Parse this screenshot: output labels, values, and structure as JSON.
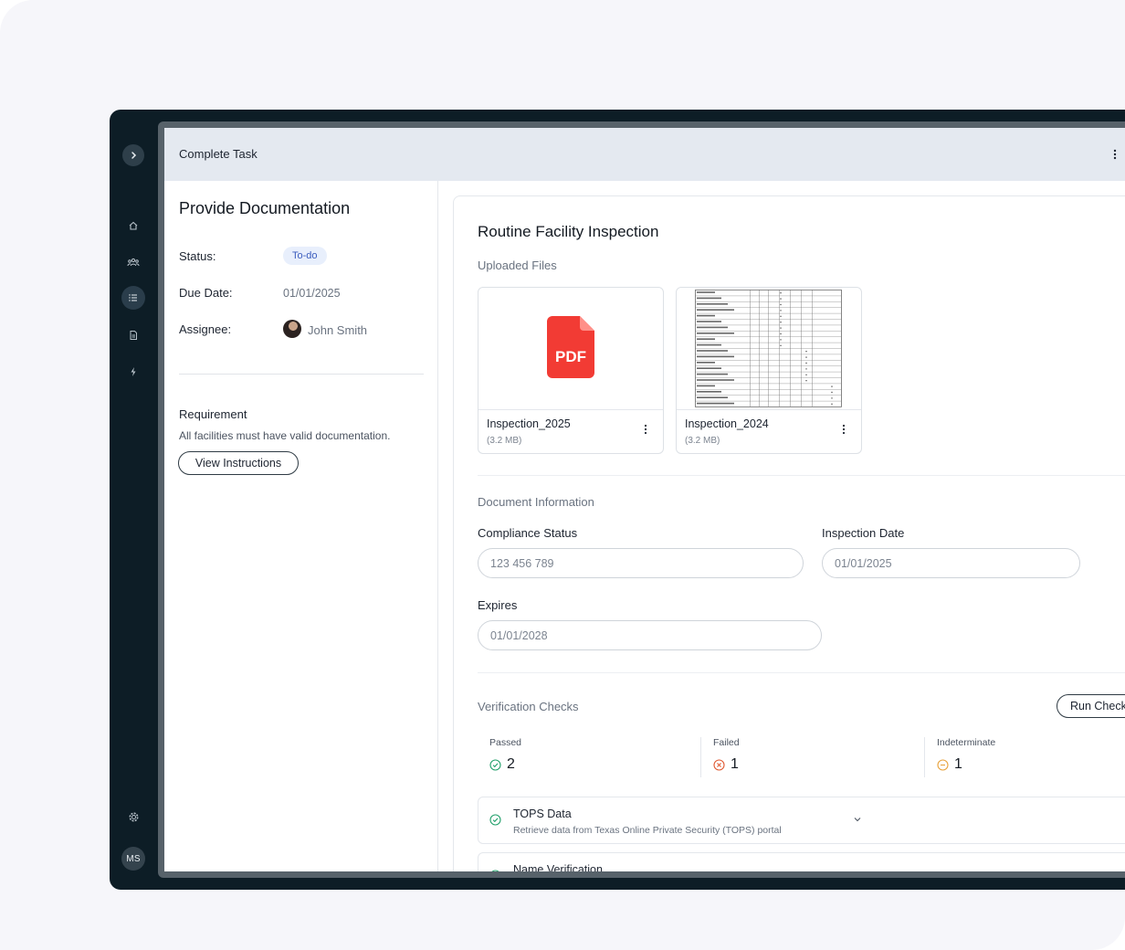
{
  "window": {
    "title": "Complete Task"
  },
  "sidebar": {
    "icons": [
      "chevron-right-icon",
      "home-icon",
      "users-icon",
      "list-icon",
      "document-icon",
      "lightning-icon",
      "gear-icon"
    ],
    "active": "list-icon",
    "user_initials": "MS"
  },
  "task": {
    "title": "Provide Documentation",
    "status_label": "Status:",
    "status_value": "To-do",
    "due_label": "Due Date:",
    "due_value": "01/01/2025",
    "assignee_label": "Assignee:",
    "assignee_value": "John Smith",
    "requirement_title": "Requirement",
    "requirement_text": "All facilities must have valid documentation.",
    "view_instructions": "View Instructions"
  },
  "inspection": {
    "title": "Routine Facility Inspection",
    "uploaded_files_label": "Uploaded Files",
    "files": [
      {
        "name": "Inspection_2025",
        "size": "(3.2 MB)",
        "preview": "pdf-icon",
        "badge": "PDF"
      },
      {
        "name": "Inspection_2024",
        "size": "(3.2 MB)",
        "preview": "spreadsheet-thumbnail"
      }
    ],
    "doc_info_label": "Document Information",
    "compliance_label": "Compliance Status",
    "compliance_value": "123 456 789",
    "inspection_date_label": "Inspection Date",
    "inspection_date_value": "01/01/2025",
    "expires_label": "Expires",
    "expires_value": "01/01/2028",
    "verification_label": "Verification Checks",
    "run_checks": "Run Checks",
    "metrics": [
      {
        "label": "Passed",
        "value": "2",
        "icon": "check-circle-icon",
        "color": "#22a06b"
      },
      {
        "label": "Failed",
        "value": "1",
        "icon": "x-circle-icon",
        "color": "#e05a33"
      },
      {
        "label": "Indeterminate",
        "value": "1",
        "icon": "minus-circle-icon",
        "color": "#e8a33d"
      }
    ],
    "checks": [
      {
        "title": "TOPS Data",
        "desc": "Retrieve data from Texas Online Private Security (TOPS) portal"
      },
      {
        "title": "Name Verification",
        "desc": ""
      }
    ]
  },
  "colors": {
    "sidebar_bg": "#0d1d26",
    "topbar_bg": "#e4e9f0",
    "pdf_red": "#f23b34",
    "status_pill_bg": "#e8effc"
  }
}
